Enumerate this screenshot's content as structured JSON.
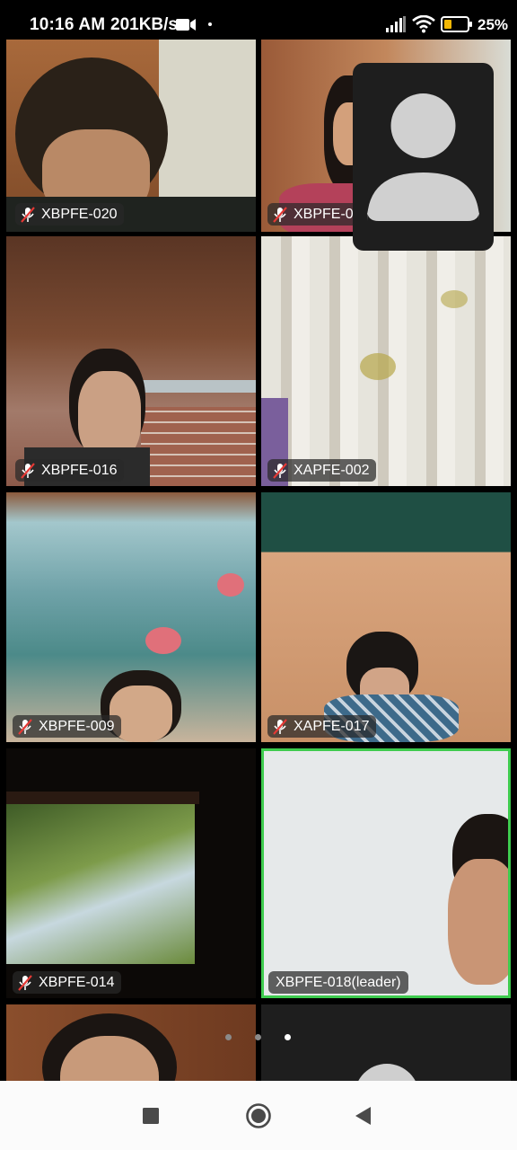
{
  "status_bar": {
    "time": "10:16 AM",
    "speed": "201KB/s",
    "battery": "25%",
    "icons": [
      "video-camera-icon",
      "signal-icon",
      "wifi-icon",
      "battery-icon"
    ]
  },
  "participants": [
    {
      "name": "XBPFE-020",
      "muted": true
    },
    {
      "name": "XBPFE-0",
      "muted": true
    },
    {
      "name": "XBPFE-016",
      "muted": true
    },
    {
      "name": "XAPFE-002",
      "muted": true
    },
    {
      "name": "XBPFE-009",
      "muted": true
    },
    {
      "name": "XAPFE-017",
      "muted": true
    },
    {
      "name": "XBPFE-014",
      "muted": true
    },
    {
      "name": "XBPFE-018(leader)",
      "muted": false,
      "active_speaker": true
    }
  ],
  "pagination": {
    "pages": 3,
    "current": 3
  },
  "colors": {
    "active_speaker_border": "#3ecb4e",
    "label_bg": "#2a2a2a",
    "mute_icon": "#e53935"
  },
  "nav_bar": {
    "buttons": [
      "recents-square-icon",
      "home-circle-icon",
      "back-triangle-icon"
    ]
  }
}
